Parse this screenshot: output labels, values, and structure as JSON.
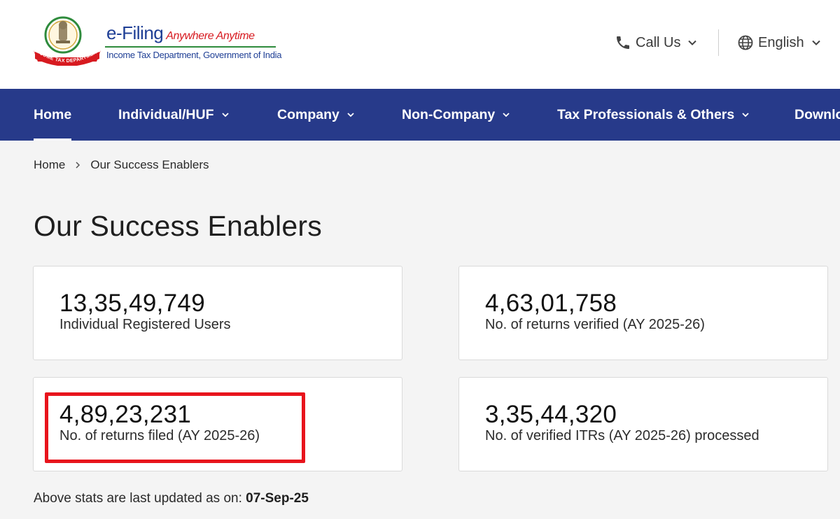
{
  "header": {
    "brand": {
      "name": "e-Filing",
      "tagline": "Anywhere Anytime",
      "subtitle": "Income Tax Department, Government of India",
      "emblem_text": "INCOME TAX DEPARTMENT"
    },
    "call_us": {
      "label": "Call Us",
      "icon": "phone-icon"
    },
    "language": {
      "label": "English",
      "icon": "globe-icon"
    }
  },
  "nav": {
    "items": [
      {
        "label": "Home",
        "active": true,
        "dropdown": false
      },
      {
        "label": "Individual/HUF",
        "dropdown": true
      },
      {
        "label": "Company",
        "dropdown": true
      },
      {
        "label": "Non-Company",
        "dropdown": true
      },
      {
        "label": "Tax Professionals & Others",
        "dropdown": true
      },
      {
        "label": "Downlo",
        "dropdown": false
      }
    ]
  },
  "breadcrumb": {
    "home": "Home",
    "current": "Our Success Enablers"
  },
  "page_title": "Our Success Enablers",
  "stats": [
    {
      "value": "13,35,49,749",
      "label": "Individual Registered Users"
    },
    {
      "value": "4,63,01,758",
      "label": "No. of returns verified (AY 2025-26)"
    },
    {
      "value": "4,89,23,231",
      "label": "No. of returns filed (AY 2025-26)",
      "highlighted": true
    },
    {
      "value": "3,35,44,320",
      "label": "No. of verified ITRs (AY 2025-26) processed"
    }
  ],
  "footer_note": {
    "prefix": "Above stats are last updated as on:",
    "date": "07-Sep-25"
  },
  "colors": {
    "nav_bg": "#273a8a",
    "brand_blue": "#1f3f95",
    "brand_red": "#d71a20",
    "highlight_red": "#e8141c",
    "page_bg": "#f4f4f4"
  }
}
